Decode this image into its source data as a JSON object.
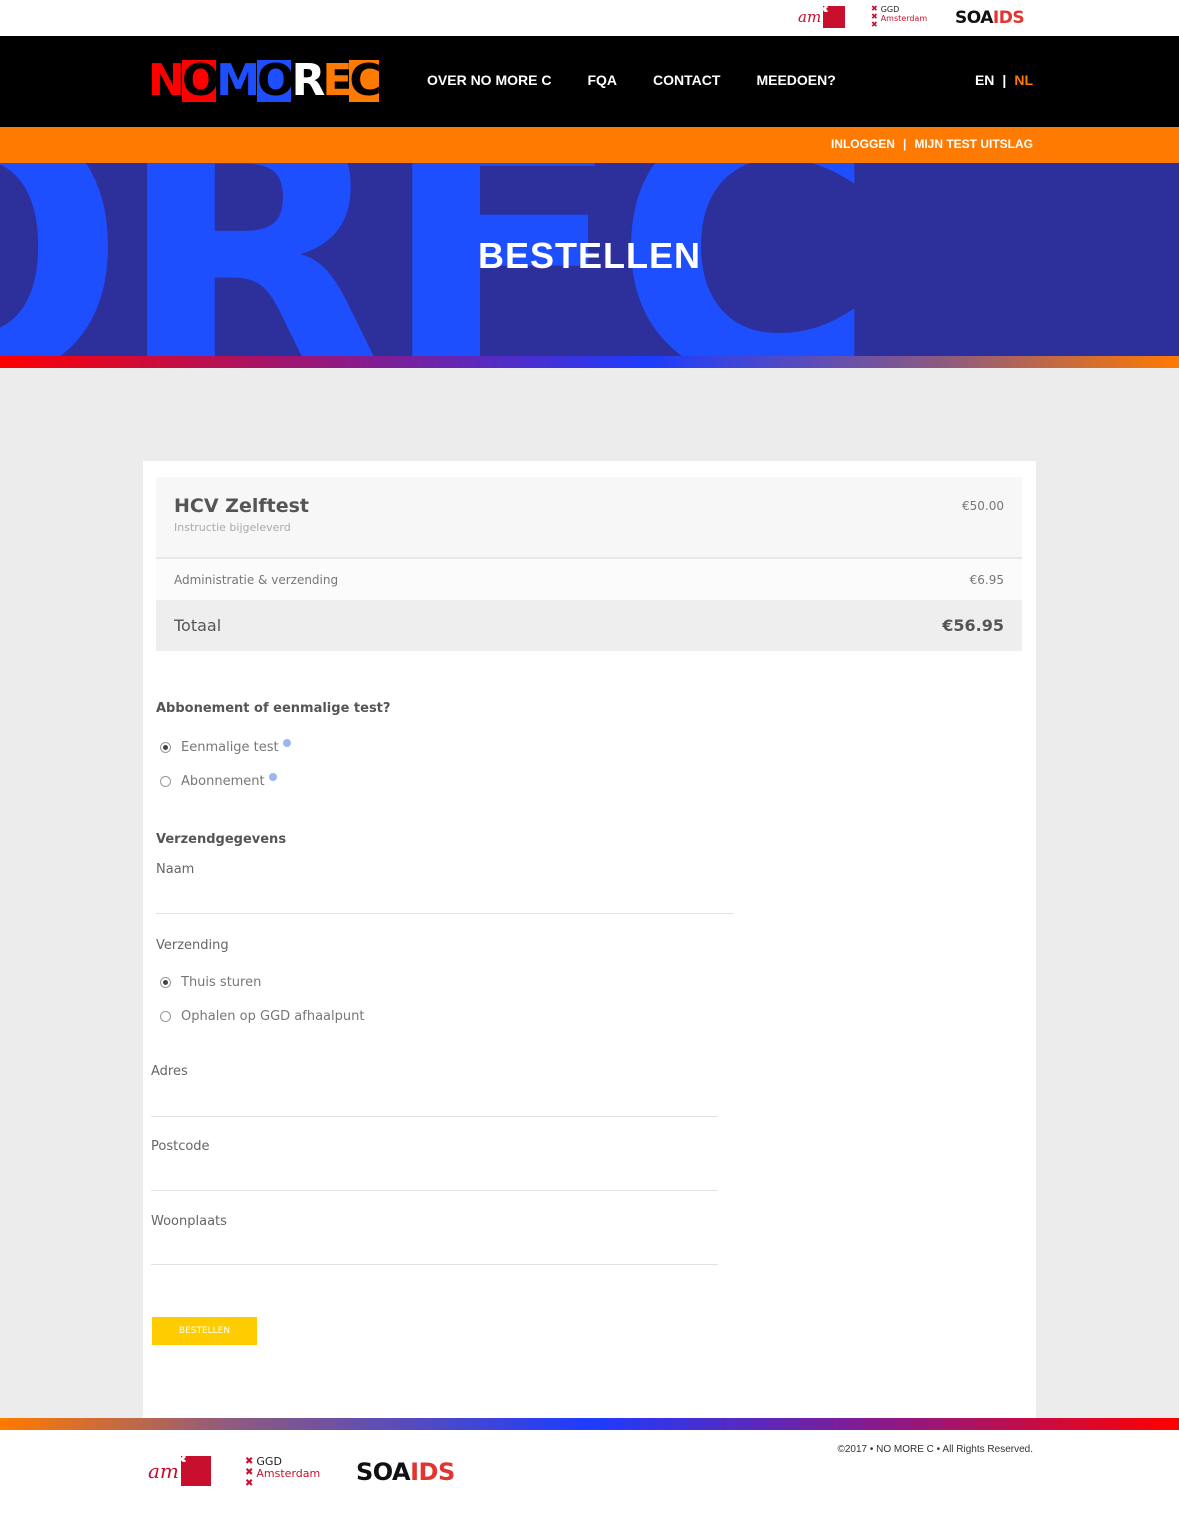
{
  "partners": {
    "amc": "am",
    "ggd_line1": "GGD",
    "ggd_line2": "Amsterdam",
    "soaids_1": "SOA",
    "soaids_2": "IDS"
  },
  "logo": {
    "letters": [
      "N",
      "O",
      "M",
      "O",
      "R",
      "E",
      "C"
    ]
  },
  "nav": {
    "items": [
      "OVER NO MORE C",
      "FQA",
      "CONTACT",
      "MEEDOEN?"
    ],
    "lang_en": "EN",
    "lang_sep": "|",
    "lang_nl": "NL"
  },
  "subnav": {
    "login": "INLOGGEN",
    "sep": "|",
    "result": "MIJN TEST UITSLAG"
  },
  "hero": {
    "bg_text": "ORFC",
    "title": "BESTELLEN"
  },
  "order": {
    "product_name": "HCV Zelftest",
    "product_desc": "Instructie bijgeleverd",
    "product_price": "€50.00",
    "admin_label": "Administratie & verzending",
    "admin_price": "€6.95",
    "total_label": "Totaal",
    "total_price": "€56.95"
  },
  "form": {
    "subscription_question": "Abbonement of eenmalige test?",
    "opt_once": "Eenmalige test",
    "opt_subscription": "Abonnement",
    "shipping_heading": "Verzendgegevens",
    "name_label": "Naam",
    "shipping_label": "Verzending",
    "opt_home": "Thuis sturen",
    "opt_pickup": "Ophalen op GGD afhaalpunt",
    "address_label": "Adres",
    "postcode_label": "Postcode",
    "city_label": "Woonplaats",
    "submit": "BESTELLEN"
  },
  "footer": {
    "copyright": "©2017 • NO MORE C  • All Rights Reserved."
  },
  "colors": {
    "orange": "#ff7a00",
    "blue": "#1d4fff",
    "navy": "#2d2f9b",
    "red": "#ff0000",
    "yellow": "#ffcc00"
  }
}
